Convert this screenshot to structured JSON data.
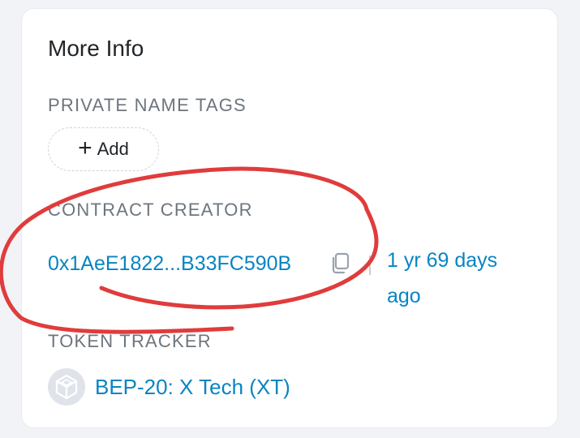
{
  "card": {
    "title": "More Info"
  },
  "private_name_tags": {
    "label": "PRIVATE NAME TAGS",
    "add_symbol": "+",
    "add_label": "Add"
  },
  "contract_creator": {
    "label": "CONTRACT CREATOR",
    "address": "0x1AeE1822...B33FC590B",
    "age": "1 yr 69 days ago"
  },
  "token_tracker": {
    "label": "TOKEN TRACKER",
    "token": "BEP-20: X Tech (XT)"
  },
  "colors": {
    "link": "#0784c3",
    "annotation": "#e03c3c",
    "muted": "#6c757d"
  },
  "icons": {
    "copy": "copy-icon",
    "token_logo": "token-cube-icon"
  }
}
